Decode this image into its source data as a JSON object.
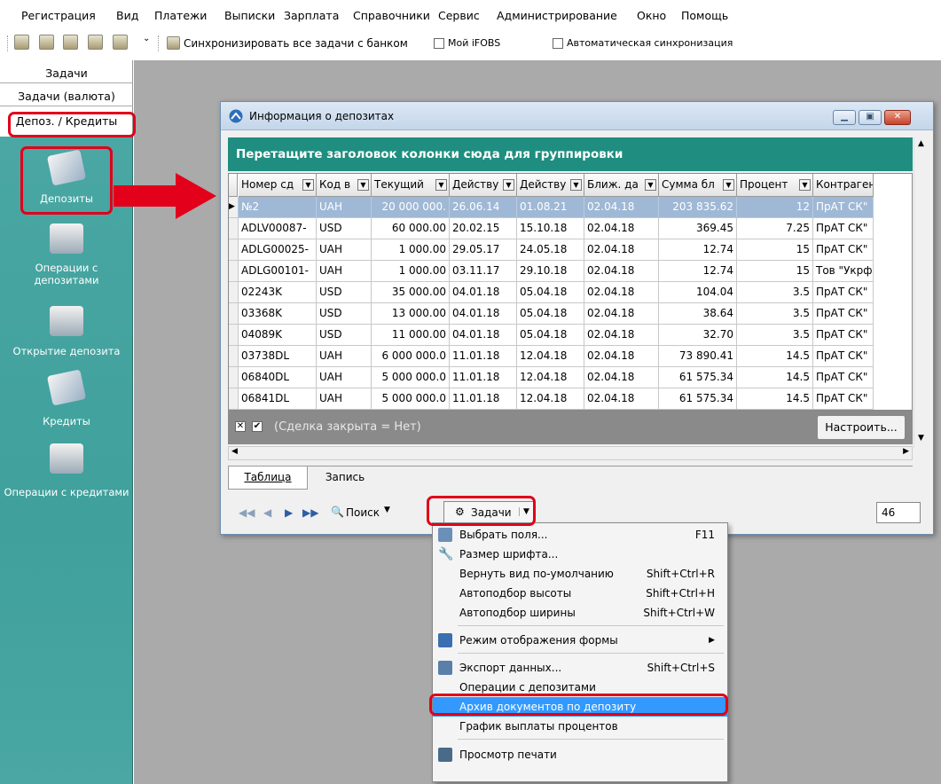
{
  "menubar": [
    "Регистрация",
    "Вид",
    "Платежи",
    "Выписки",
    "Зарплата",
    "Справочники",
    "Сервис",
    "Администрирование",
    "Окно",
    "Помощь"
  ],
  "toolbar": {
    "sync_label": "Синхронизировать все задачи с банком",
    "my_ifobs": "Мой iFOBS",
    "auto_sync": "Автоматическая синхронизация"
  },
  "sidetabs": [
    "Задачи",
    "Задачи (валюта)",
    "Депоз. / Кредиты"
  ],
  "sidebar": [
    "Депозиты",
    "Операции с депозитами",
    "Открытие депозита",
    "Кредиты",
    "Операции с кредитами"
  ],
  "window": {
    "title": "Информация о депозитах",
    "group_hint": "Перетащите заголовок колонки сюда для группировки",
    "columns": [
      "Номер сд",
      "Код в",
      "Текущий",
      "Действу",
      "Действу",
      "Ближ. да",
      "Сумма бл",
      "Процент",
      "Контраген"
    ],
    "rows": [
      [
        "№2",
        "UAH",
        "20 000 000.",
        "26.06.14",
        "01.08.21",
        "02.04.18",
        "203 835.62",
        "12",
        "ПрАТ СК\""
      ],
      [
        "ADLV00087-",
        "USD",
        "60 000.00",
        "20.02.15",
        "15.10.18",
        "02.04.18",
        "369.45",
        "7.25",
        "ПрАТ СК\""
      ],
      [
        "ADLG00025-",
        "UAH",
        "1 000.00",
        "29.05.17",
        "24.05.18",
        "02.04.18",
        "12.74",
        "15",
        "ПрАТ СК\""
      ],
      [
        "ADLG00101-",
        "UAH",
        "1 000.00",
        "03.11.17",
        "29.10.18",
        "02.04.18",
        "12.74",
        "15",
        "Тов \"Укрф"
      ],
      [
        "02243K",
        "USD",
        "35 000.00",
        "04.01.18",
        "05.04.18",
        "02.04.18",
        "104.04",
        "3.5",
        "ПрАТ СК\""
      ],
      [
        "03368K",
        "USD",
        "13 000.00",
        "04.01.18",
        "05.04.18",
        "02.04.18",
        "38.64",
        "3.5",
        "ПрАТ СК\""
      ],
      [
        "04089K",
        "USD",
        "11 000.00",
        "04.01.18",
        "05.04.18",
        "02.04.18",
        "32.70",
        "3.5",
        "ПрАТ СК\""
      ],
      [
        "03738DL",
        "UAH",
        "6 000 000.0",
        "11.01.18",
        "12.04.18",
        "02.04.18",
        "73 890.41",
        "14.5",
        "ПрАТ СК\""
      ],
      [
        "06840DL",
        "UAH",
        "5 000 000.0",
        "11.01.18",
        "12.04.18",
        "02.04.18",
        "61 575.34",
        "14.5",
        "ПрАТ СК\""
      ],
      [
        "06841DL",
        "UAH",
        "5 000 000.0",
        "11.01.18",
        "12.04.18",
        "02.04.18",
        "61 575.34",
        "14.5",
        "ПрАТ СК\""
      ]
    ],
    "filter": "(Сделка закрыта = Нет)",
    "configure": "Настроить...",
    "tab_table": "Таблица",
    "tab_record": "Запись",
    "search": "Поиск",
    "tasks": "Задачи",
    "count": "46"
  },
  "context_menu": [
    {
      "label": "Выбрать поля...",
      "key": "F11"
    },
    {
      "label": "Размер шрифта...",
      "key": ""
    },
    {
      "label": "Вернуть вид по-умолчанию",
      "key": "Shift+Ctrl+R"
    },
    {
      "label": "Автоподбор высоты",
      "key": "Shift+Ctrl+H"
    },
    {
      "label": "Автоподбор ширины",
      "key": "Shift+Ctrl+W"
    },
    {
      "label": "Режим отображения формы",
      "key": ""
    },
    {
      "label": "Экспорт данных...",
      "key": "Shift+Ctrl+S"
    },
    {
      "label": "Операции с депозитами",
      "key": ""
    },
    {
      "label": "Архив документов по депозиту",
      "key": ""
    },
    {
      "label": "График выплаты процентов",
      "key": ""
    },
    {
      "label": "Просмотр печати",
      "key": ""
    }
  ]
}
